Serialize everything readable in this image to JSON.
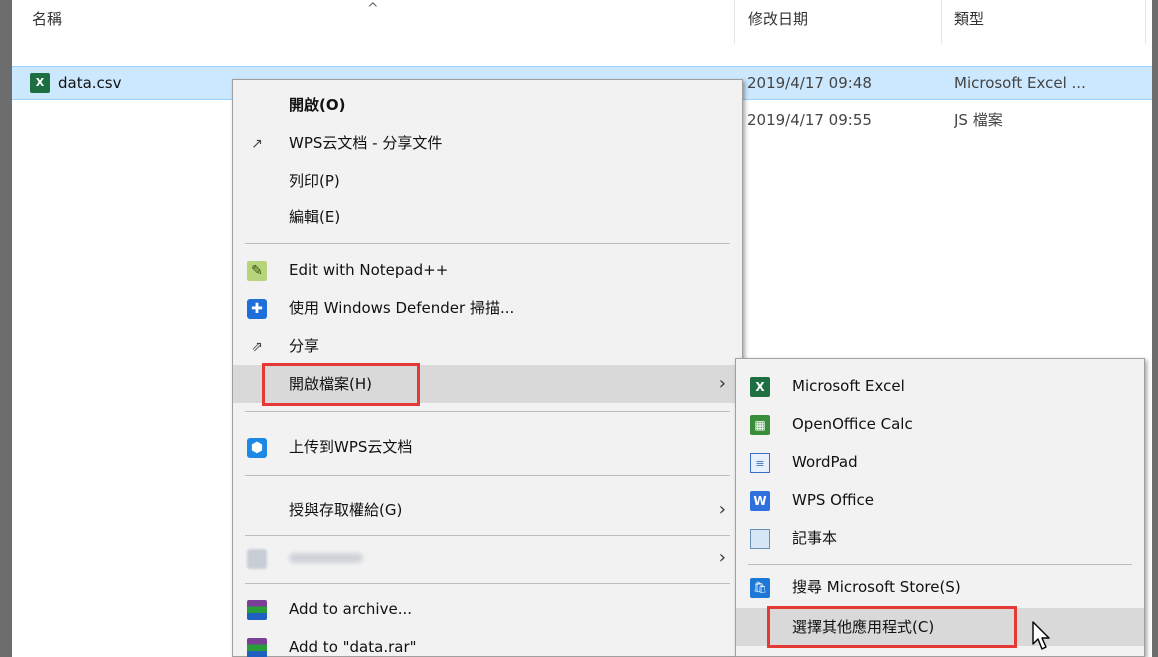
{
  "columns": {
    "name": "名稱",
    "date": "修改日期",
    "type": "類型",
    "sort_indicator": "^"
  },
  "files": [
    {
      "name": "data.csv",
      "date": "2019/4/17 09:48",
      "type": "Microsoft Excel ...",
      "selected": true,
      "icon": "excel-csv-icon"
    },
    {
      "name": "",
      "date": "2019/4/17 09:55",
      "type": "JS 檔案",
      "selected": false,
      "icon": ""
    }
  ],
  "context_menu": {
    "open": "開啟(O)",
    "wps_share": "WPS云文档 - 分享文件",
    "print": "列印(P)",
    "edit": "編輯(E)",
    "notepadpp": "Edit with Notepad++",
    "defender": "使用 Windows Defender 掃描...",
    "share": "分享",
    "open_with": "開啟檔案(H)",
    "upload_wps": "上传到WPS云文档",
    "grant_access": "授與存取權給(G)",
    "blurred_item": "",
    "add_archive": "Add to archive...",
    "add_rar": "Add to \"data.rar\""
  },
  "submenu": {
    "excel": "Microsoft Excel",
    "oocalc": "OpenOffice Calc",
    "wordpad": "WordPad",
    "wps": "WPS Office",
    "notepad": "記事本",
    "store": "搜尋 Microsoft Store(S)",
    "choose": "選擇其他應用程式(C)"
  },
  "colors": {
    "selected_row": "#cce8ff",
    "highlight_box": "#e53935",
    "menu_bg": "#f2f2f2"
  }
}
